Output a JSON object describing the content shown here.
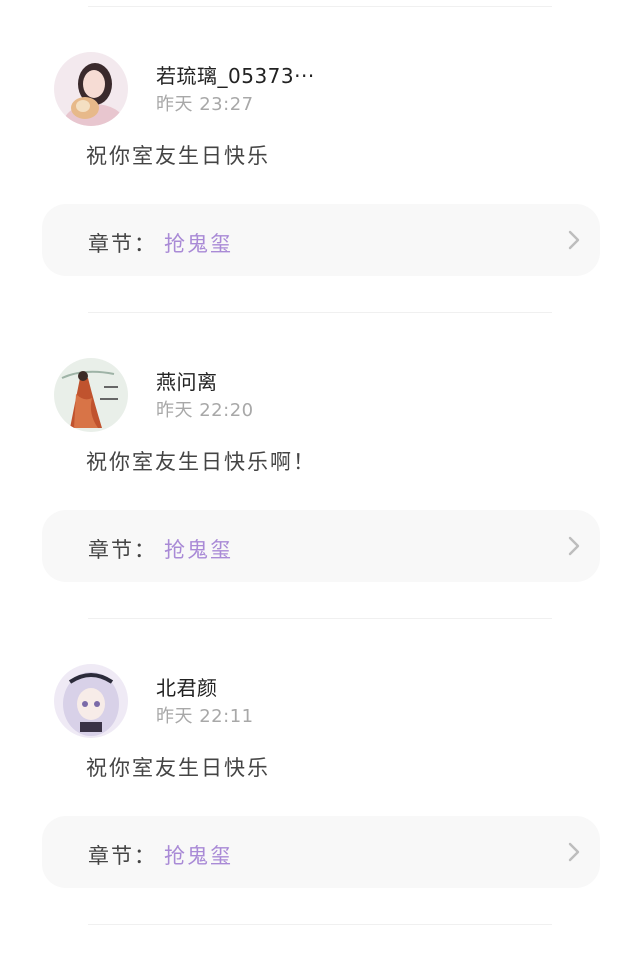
{
  "comments": [
    {
      "username": "若琉璃_05373···",
      "time": "昨天 23:27",
      "text": "祝你室友生日快乐",
      "chapter_label": "章节：",
      "chapter_name": "抢鬼玺",
      "avatar": "girl-with-dog-photo"
    },
    {
      "username": "燕问离",
      "time": "昨天 22:20",
      "text": "祝你室友生日快乐啊！",
      "chapter_label": "章节：",
      "chapter_name": "抢鬼玺",
      "avatar": "red-robe-illustration"
    },
    {
      "username": "北君颜",
      "time": "昨天 22:11",
      "text": "祝你室友生日快乐",
      "chapter_label": "章节：",
      "chapter_name": "抢鬼玺",
      "avatar": "anime-girl-illustration"
    }
  ],
  "colors": {
    "chapter_link": "#a98ad6",
    "timestamp": "#a8a8a8",
    "card_bg": "#f8f8f8"
  }
}
